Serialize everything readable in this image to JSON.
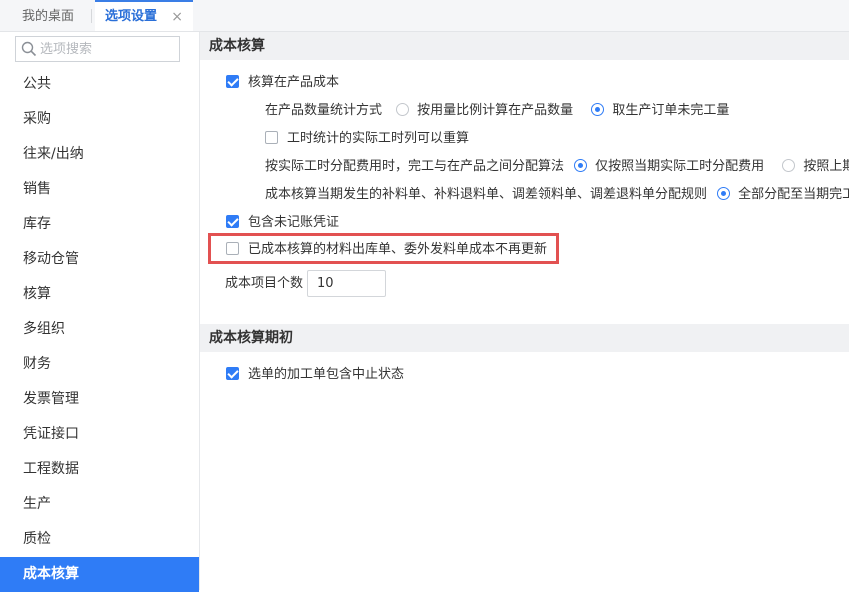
{
  "tabs": [
    {
      "label": "我的桌面"
    },
    {
      "label": "选项设置",
      "close": "×"
    }
  ],
  "sidebar": {
    "search_placeholder": "选项搜索",
    "items": [
      {
        "label": "公共"
      },
      {
        "label": "采购"
      },
      {
        "label": "往来/出纳"
      },
      {
        "label": "销售"
      },
      {
        "label": "库存"
      },
      {
        "label": "移动仓管"
      },
      {
        "label": "核算"
      },
      {
        "label": "多组织"
      },
      {
        "label": "财务"
      },
      {
        "label": "发票管理"
      },
      {
        "label": "凭证接口"
      },
      {
        "label": "工程数据"
      },
      {
        "label": "生产"
      },
      {
        "label": "质检"
      },
      {
        "label": "成本核算"
      }
    ],
    "active_index": 14
  },
  "section1": {
    "title": "成本核算",
    "product_cost": {
      "label": "核算在产品成本",
      "checked": true
    },
    "qty_method": {
      "label": "在产品数量统计方式",
      "option1": "按用量比例计算在产品数量",
      "option2": "取生产订单未完工量",
      "selected": 2
    },
    "recalc": {
      "label": "工时统计的实际工时列可以重算",
      "checked": false
    },
    "alloc_method": {
      "label": "按实际工时分配费用时，完工与在产品之间分配算法",
      "option1": "仅按照当期实际工时分配费用",
      "option2": "按照上期在产",
      "selected": 1
    },
    "alloc_rule": {
      "label": "成本核算当期发生的补料单、补料退料单、调差领料单、调差退料单分配规则",
      "option1": "全部分配至当期完工品",
      "selected": 1
    },
    "include_voucher": {
      "label": "包含未记账凭证",
      "checked": true
    },
    "no_update": {
      "label": "已成本核算的材料出库单、委外发料单成本不再更新",
      "checked": false
    },
    "item_count": {
      "label": "成本项目个数",
      "value": "10"
    }
  },
  "section2": {
    "title": "成本核算期初",
    "include_stopped": {
      "label": "选单的加工单包含中止状态",
      "checked": true
    }
  },
  "colors": {
    "accent": "#2f7cf6",
    "highlight": "#e25151"
  }
}
